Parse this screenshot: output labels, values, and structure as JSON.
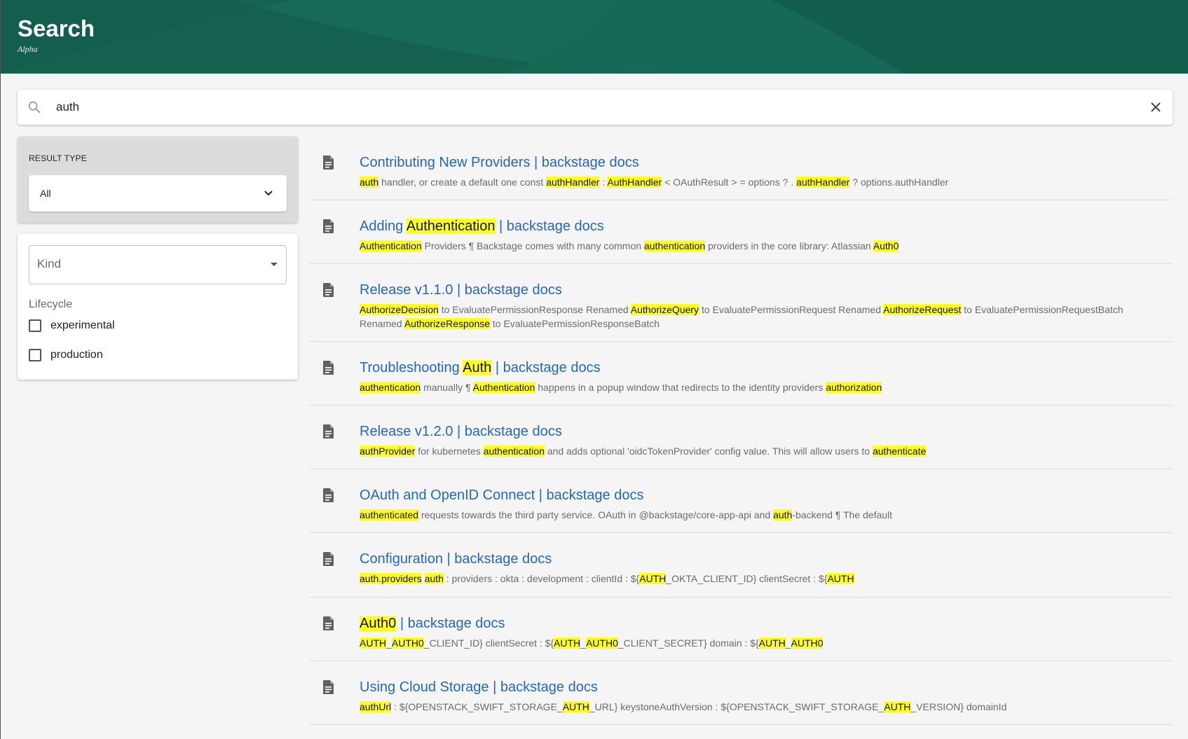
{
  "header": {
    "title": "Search",
    "subtitle": "Alpha",
    "color": "#14614f"
  },
  "search": {
    "value": "auth",
    "placeholder": ""
  },
  "filters": {
    "result_type": {
      "label": "RESULT TYPE",
      "selected": "All"
    },
    "kind": {
      "placeholder": "Kind"
    },
    "lifecycle": {
      "label": "Lifecycle",
      "options": [
        {
          "label": "experimental",
          "checked": false
        },
        {
          "label": "production",
          "checked": false
        }
      ]
    }
  },
  "results": [
    {
      "title": [
        {
          "t": "Contributing New Providers | backstage docs"
        }
      ],
      "snippet": [
        {
          "t": "auth",
          "h": true
        },
        {
          "t": " handler, or create a default one const "
        },
        {
          "t": "authHandler",
          "h": true
        },
        {
          "t": " : "
        },
        {
          "t": "AuthHandler",
          "h": true
        },
        {
          "t": " < OAuthResult > = options ? . "
        },
        {
          "t": "authHandler",
          "h": true
        },
        {
          "t": " ? options.authHandler"
        }
      ]
    },
    {
      "title": [
        {
          "t": "Adding "
        },
        {
          "t": "Authentication",
          "h": true
        },
        {
          "t": " | backstage docs"
        }
      ],
      "snippet": [
        {
          "t": "Authentication",
          "h": true
        },
        {
          "t": " Providers ¶ Backstage comes with many common "
        },
        {
          "t": "authentication",
          "h": true
        },
        {
          "t": " providers in the core library: Atlassian "
        },
        {
          "t": "Auth0",
          "h": true
        }
      ]
    },
    {
      "title": [
        {
          "t": "Release v1.1.0 | backstage docs"
        }
      ],
      "snippet": [
        {
          "t": "AuthorizeDecision",
          "h": true
        },
        {
          "t": " to EvaluatePermissionResponse Renamed "
        },
        {
          "t": "AuthorizeQuery",
          "h": true
        },
        {
          "t": " to EvaluatePermissionRequest Renamed "
        },
        {
          "t": "AuthorizeRequest",
          "h": true
        },
        {
          "t": " to EvaluatePermissionRequestBatch Renamed "
        },
        {
          "t": "AuthorizeResponse",
          "h": true
        },
        {
          "t": " to EvaluatePermissionResponseBatch"
        }
      ]
    },
    {
      "title": [
        {
          "t": "Troubleshooting "
        },
        {
          "t": "Auth",
          "h": true
        },
        {
          "t": " | backstage docs"
        }
      ],
      "snippet": [
        {
          "t": "authentication",
          "h": true
        },
        {
          "t": " manually ¶ "
        },
        {
          "t": "Authentication",
          "h": true
        },
        {
          "t": " happens in a popup window that redirects to the identity providers "
        },
        {
          "t": "authorization",
          "h": true
        }
      ]
    },
    {
      "title": [
        {
          "t": "Release v1.2.0 | backstage docs"
        }
      ],
      "snippet": [
        {
          "t": "authProvider",
          "h": true
        },
        {
          "t": " for kubernetes "
        },
        {
          "t": "authentication",
          "h": true
        },
        {
          "t": " and adds optional 'oidcTokenProvider' config value. This will allow users to "
        },
        {
          "t": "authenticate",
          "h": true
        }
      ]
    },
    {
      "title": [
        {
          "t": "OAuth and OpenID Connect | backstage docs"
        }
      ],
      "snippet": [
        {
          "t": "authenticated",
          "h": true
        },
        {
          "t": " requests towards the third party service. OAuth in @backstage/core-app-api and "
        },
        {
          "t": "auth",
          "h": true
        },
        {
          "t": "-backend ¶ The default"
        }
      ]
    },
    {
      "title": [
        {
          "t": "Configuration | backstage docs"
        }
      ],
      "snippet": [
        {
          "t": "auth.providers",
          "h": true
        },
        {
          "t": " "
        },
        {
          "t": "auth",
          "h": true
        },
        {
          "t": " : providers : okta : development : clientId : ${"
        },
        {
          "t": "AUTH",
          "h": true
        },
        {
          "t": "_OKTA_CLIENT_ID} clientSecret : ${"
        },
        {
          "t": "AUTH",
          "h": true
        }
      ]
    },
    {
      "title": [
        {
          "t": "Auth0",
          "h": true
        },
        {
          "t": " | backstage docs"
        }
      ],
      "snippet": [
        {
          "t": "AUTH",
          "h": true
        },
        {
          "t": "_"
        },
        {
          "t": "AUTH0",
          "h": true
        },
        {
          "t": "_CLIENT_ID} clientSecret : ${"
        },
        {
          "t": "AUTH",
          "h": true
        },
        {
          "t": "_"
        },
        {
          "t": "AUTH0",
          "h": true
        },
        {
          "t": "_CLIENT_SECRET} domain : ${"
        },
        {
          "t": "AUTH",
          "h": true
        },
        {
          "t": "_"
        },
        {
          "t": "AUTH0",
          "h": true
        }
      ]
    },
    {
      "title": [
        {
          "t": "Using Cloud Storage | backstage docs"
        }
      ],
      "snippet": [
        {
          "t": "authUrl",
          "h": true
        },
        {
          "t": " : ${OPENSTACK_SWIFT_STORAGE_"
        },
        {
          "t": "AUTH",
          "h": true
        },
        {
          "t": "_URL} keystoneAuthVersion : ${OPENSTACK_SWIFT_STORAGE_"
        },
        {
          "t": "AUTH",
          "h": true
        },
        {
          "t": "_VERSION} domainId"
        }
      ]
    }
  ],
  "colors": {
    "link": "#2367c5",
    "highlight": "#ffff1a"
  },
  "icons": {
    "search": "search-icon",
    "clear": "close-icon",
    "dropdown": "chevron-down-icon",
    "result": "document-icon"
  }
}
